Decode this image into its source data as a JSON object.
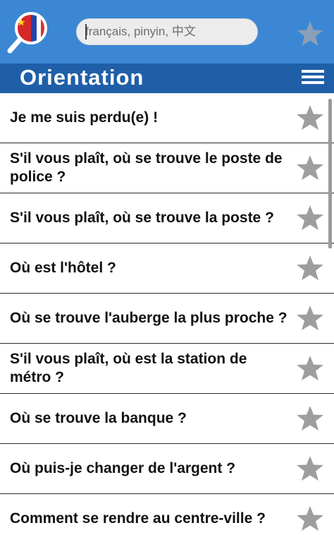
{
  "header": {
    "search_placeholder": "français, pinyin, 中文",
    "logo_icon": "china-france-flag-magnifier-icon",
    "favorite_icon": "star-icon"
  },
  "titlebar": {
    "title": "Orientation",
    "menu_icon": "hamburger-menu-icon"
  },
  "colors": {
    "topbar": "#3b87d4",
    "titlebar": "#1f5fa8",
    "star": "#9e9e9e"
  },
  "phrases": [
    "Je me suis perdu(e) !",
    "S'il vous plaît, où se trouve le poste de police ?",
    "S'il vous plaît, où se trouve la poste ?",
    "Où est l'hôtel ?",
    "Où se trouve l'auberge la plus proche ?",
    "S'il vous plaît, où est la station de métro ?",
    "Où se trouve la banque ?",
    "Où puis-je changer de l'argent ?",
    "Comment se rendre au centre-ville ?"
  ]
}
